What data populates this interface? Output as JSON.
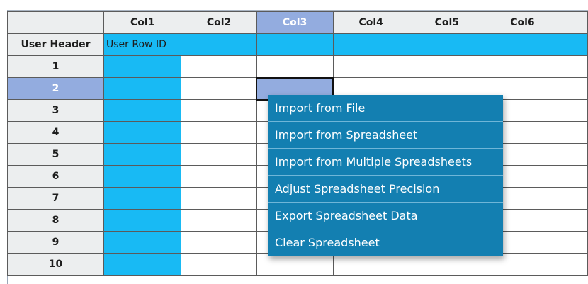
{
  "grid": {
    "corner_label": "",
    "columns": [
      "Col1",
      "Col2",
      "Col3",
      "Col4",
      "Col5",
      "Col6",
      ""
    ],
    "selected_column": "Col3",
    "header_row_label": "User Header",
    "header_row_first_value": "User Row ID",
    "row_labels": [
      "1",
      "2",
      "3",
      "4",
      "5",
      "6",
      "7",
      "8",
      "9",
      "10"
    ],
    "selected_row": "2",
    "colors": {
      "cyan": "#18baf4",
      "selection": "#93acdf",
      "header_bg": "#eceeef"
    }
  },
  "context_menu": {
    "items": [
      "Import from File",
      "Import from Spreadsheet",
      "Import from Multiple Spreadsheets",
      "Adjust Spreadsheet Precision",
      "Export Spreadsheet Data",
      "Clear Spreadsheet"
    ],
    "background": "#137fb1"
  }
}
